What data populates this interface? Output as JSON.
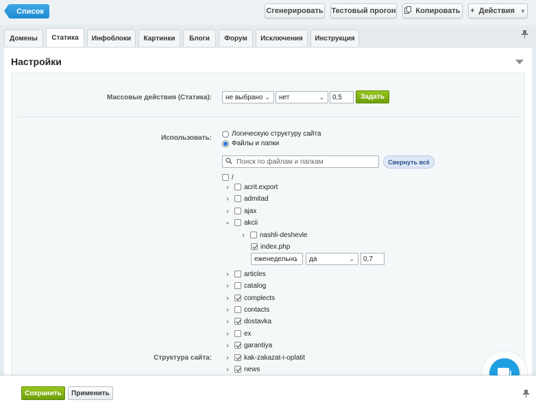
{
  "toolbar": {
    "back_label": "Список",
    "generate_label": "Сгенерировать",
    "test_run_label": "Тестовый прогон",
    "copy_label": "Копировать",
    "actions_label": "Действия"
  },
  "tabs": [
    {
      "label": "Домены"
    },
    {
      "label": "Статика"
    },
    {
      "label": "Инфоблоки"
    },
    {
      "label": "Картинки"
    },
    {
      "label": "Блоги"
    },
    {
      "label": "Форум"
    },
    {
      "label": "Исключения"
    },
    {
      "label": "Инструкция"
    }
  ],
  "active_tab": "Статика",
  "panel": {
    "title": "Настройки"
  },
  "mass_actions": {
    "label": "Массовые действия (Статика):",
    "select1_value": "не выбрано",
    "select2_value": "нет",
    "priority_value": "0,5",
    "apply_label": "Задать"
  },
  "use": {
    "label": "Использовать:",
    "options": [
      {
        "label": "Логическую структуру сайта",
        "selected": false
      },
      {
        "label": "Файлы и папки",
        "selected": true
      }
    ]
  },
  "search": {
    "placeholder": "Поиск по файлам и папкам",
    "collapse_label": "Свернуть всё"
  },
  "tree": {
    "root_label": "/",
    "items": [
      {
        "label": "acrit.export",
        "checked": false,
        "expanded": false
      },
      {
        "label": "admitad",
        "checked": false,
        "expanded": false
      },
      {
        "label": "ajax",
        "checked": false,
        "expanded": false
      },
      {
        "label": "akcii",
        "checked": false,
        "expanded": true
      },
      {
        "label": "nashli-deshevle",
        "checked": false,
        "expanded": false
      },
      {
        "label": "index.php",
        "checked": true
      },
      {
        "label": "articles",
        "checked": false,
        "expanded": false
      },
      {
        "label": "catalog",
        "checked": false,
        "expanded": false
      },
      {
        "label": "complects",
        "checked": true,
        "expanded": false
      },
      {
        "label": "contacts",
        "checked": false,
        "expanded": false
      },
      {
        "label": "dostavka",
        "checked": true,
        "expanded": false
      },
      {
        "label": "ex",
        "checked": false,
        "expanded": false
      },
      {
        "label": "garantiya",
        "checked": true,
        "expanded": false
      },
      {
        "label": "kak-zakazat-i-oplatit",
        "checked": true,
        "expanded": false
      },
      {
        "label": "news",
        "checked": true,
        "expanded": false
      }
    ],
    "file_settings": {
      "frequency_value": "еженедельно",
      "active_value": "да",
      "priority_value": "0,7"
    }
  },
  "structure_label": "Структура сайта:",
  "footer": {
    "save_label": "Сохранить",
    "apply_label": "Применить"
  },
  "colors": {
    "accent_blue": "#1e9fe0",
    "green_button": "#7fae13"
  }
}
